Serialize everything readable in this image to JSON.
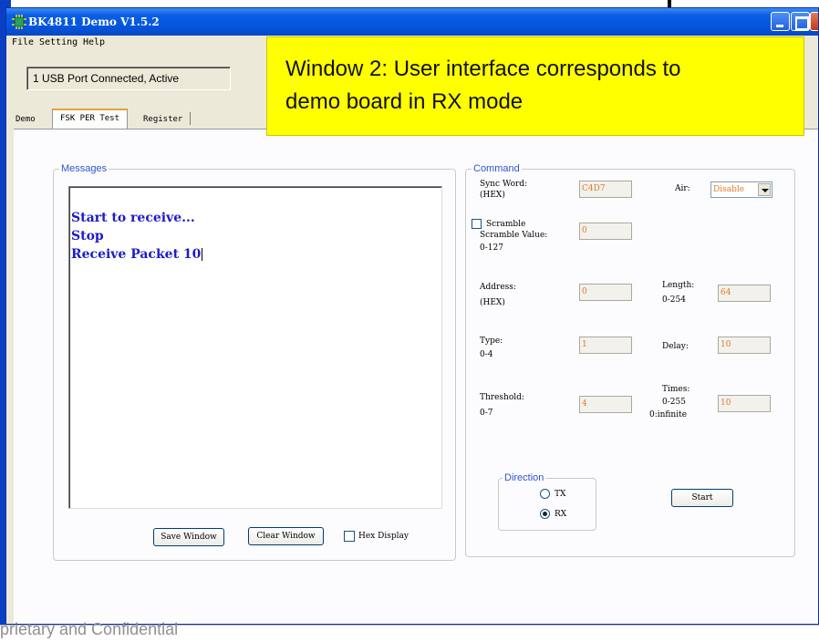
{
  "window": {
    "title": "BK4811 Demo V1.5.2",
    "icon": "app-chip-icon"
  },
  "menubar": {
    "items": [
      "File",
      "Setting",
      "Help"
    ]
  },
  "status": {
    "text": "1 USB Port Connected, Active"
  },
  "tabs": [
    {
      "label": "Demo",
      "active": false
    },
    {
      "label": "FSK PER Test",
      "active": true
    },
    {
      "label": "Register",
      "active": false
    }
  ],
  "messages": {
    "group_label": "Messages",
    "lines": [
      "Start to receive...",
      "Stop",
      "Receive Packet 10"
    ],
    "save_label": "Save Window",
    "clear_label": "Clear Window",
    "hex_display_label": "Hex Display"
  },
  "command": {
    "group_label": "Command",
    "sync_word_label": "Sync Word:",
    "sync_word_sub": "(HEX)",
    "sync_word_value": "C4D7",
    "air_label": "Air:",
    "air_value": "Disable",
    "scramble_label": "Scramble",
    "scramble_value_label": "Scramble Value:",
    "scramble_range": "0-127",
    "scramble_value": "0",
    "address_label": "Address:",
    "address_sub": "(HEX)",
    "address_value": "0",
    "length_label": "Length:",
    "length_range": "0-254",
    "length_value": "64",
    "type_label": "Type:",
    "type_range": "0-4",
    "type_value": "1",
    "delay_label": "Delay:",
    "delay_value": "10",
    "threshold_label": "Threshold:",
    "threshold_range": "0-7",
    "threshold_value": "4",
    "times_label": "Times:",
    "times_range": "0-255",
    "times_note": "0:infinite",
    "times_value": "10",
    "direction_label": "Direction",
    "tx_label": "TX",
    "rx_label": "RX",
    "direction_selected": "RX",
    "start_label": "Start"
  },
  "annotation": {
    "line1": "Window 2: User interface corresponds to",
    "line2": "demo board in RX mode"
  },
  "footer": {
    "text": "prietary and Confidential"
  },
  "colors": {
    "title_blue": "#0555dc",
    "message_text": "#1c1cc8",
    "field_text": "#e07b2a",
    "annotation_bg": "#ffff00"
  }
}
